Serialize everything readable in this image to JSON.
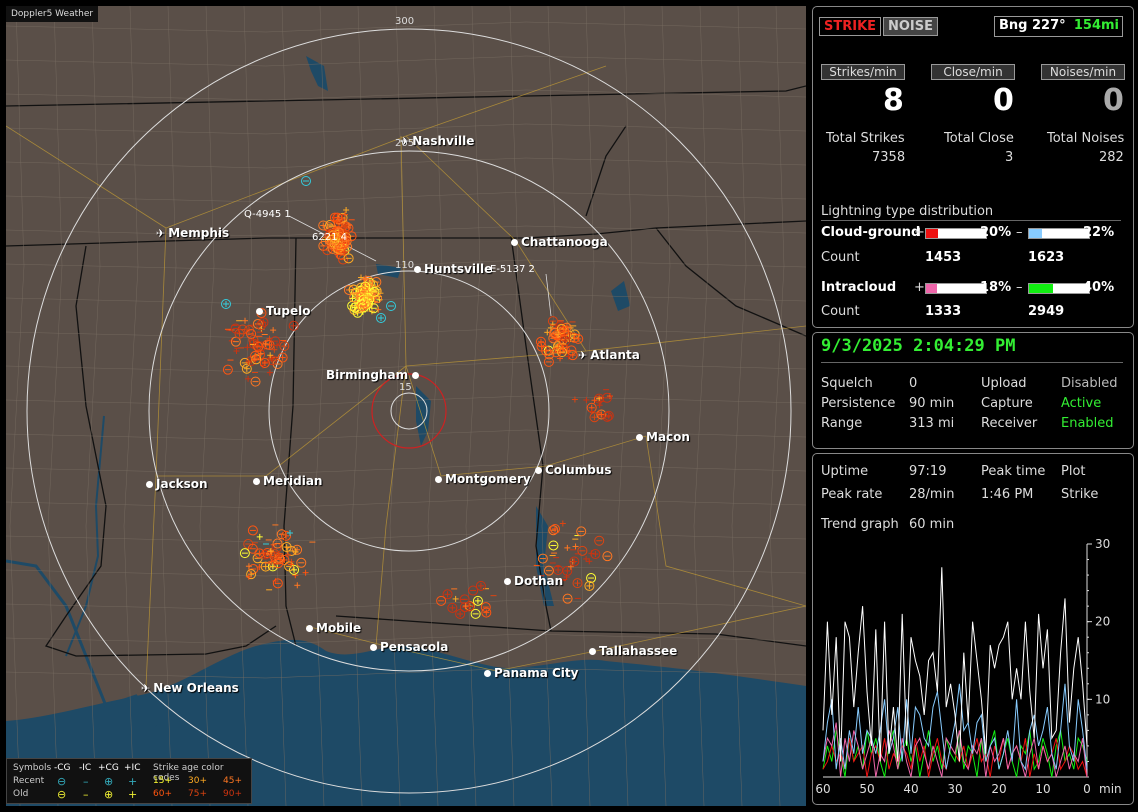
{
  "app": {
    "title": "Doppler5 Weather"
  },
  "map": {
    "range_labels": [
      "300",
      "205",
      "110",
      "15"
    ],
    "cities": [
      {
        "name": "Nashville",
        "type": "airport"
      },
      {
        "name": "Memphis",
        "type": "airport"
      },
      {
        "name": "Chattanooga",
        "type": "city"
      },
      {
        "name": "Huntsville",
        "type": "city"
      },
      {
        "name": "Tupelo",
        "type": "city"
      },
      {
        "name": "Atlanta",
        "type": "airport"
      },
      {
        "name": "Birmingham",
        "type": "city"
      },
      {
        "name": "Macon",
        "type": "city"
      },
      {
        "name": "Jackson",
        "type": "city"
      },
      {
        "name": "Meridian",
        "type": "city"
      },
      {
        "name": "Montgomery",
        "type": "city"
      },
      {
        "name": "Columbus",
        "type": "city"
      },
      {
        "name": "Dothan",
        "type": "city"
      },
      {
        "name": "Mobile",
        "type": "city"
      },
      {
        "name": "Pensacola",
        "type": "city"
      },
      {
        "name": "Tallahassee",
        "type": "city"
      },
      {
        "name": "Panama City",
        "type": "city"
      },
      {
        "name": "New Orleans",
        "type": "airport"
      }
    ],
    "projections": [
      "Q-4945 1",
      "6221 4",
      "E-5137 2"
    ],
    "colors": {
      "land": "#5a4f48",
      "water": "#1e4a66",
      "range_ring": "#dddddd",
      "close_ring": "#cc2222"
    }
  },
  "legend": {
    "symbols_label": "Symbols",
    "headers": [
      "-CG",
      "-IC",
      "+CG",
      "+IC"
    ],
    "recent_label": "Recent",
    "old_label": "Old",
    "age_label": "Strike age color codes",
    "recent_ages": [
      "15+",
      "30+",
      "45+"
    ],
    "old_ages": [
      "60+",
      "75+",
      "90+"
    ],
    "age_colors": [
      "#ffff33",
      "#ffaa22",
      "#ff7722",
      "#ff5511",
      "#dd4411",
      "#cc3311"
    ]
  },
  "status": {
    "strike_btn": "STRIKE",
    "noise_btn": "NOISE",
    "bearing": "Bng 227°",
    "distance": "154mi",
    "headers": [
      "Strikes/min",
      "Close/min",
      "Noises/min"
    ],
    "strikes_per_min": "8",
    "close_per_min": "0",
    "noises_per_min": "0",
    "total_labels": [
      "Total Strikes",
      "Total Close",
      "Total Noises"
    ],
    "total_strikes": "7358",
    "total_close": "3",
    "total_noises": "282"
  },
  "distribution": {
    "title": "Lightning type distribution",
    "cloud_ground_label": "Cloud-ground",
    "intracloud_label": "Intracloud",
    "count_label": "Count",
    "plus": "+",
    "minus": "–",
    "cg_pos_pct": "20%",
    "cg_pos_frac": 0.2,
    "cg_pos_color": "#ee1111",
    "cg_neg_pct": "22%",
    "cg_neg_frac": 0.22,
    "cg_neg_color": "#88ccff",
    "cg_pos_count": "1453",
    "cg_neg_count": "1623",
    "ic_pos_pct": "18%",
    "ic_pos_frac": 0.18,
    "ic_pos_color": "#ee66aa",
    "ic_neg_pct": "40%",
    "ic_neg_frac": 0.4,
    "ic_neg_color": "#11ee11",
    "ic_pos_count": "1333",
    "ic_neg_count": "2949"
  },
  "settings": {
    "datetime": "9/3/2025 2:04:29 PM",
    "squelch_label": "Squelch",
    "squelch": "0",
    "persistence_label": "Persistence",
    "persistence": "90 min",
    "range_label": "Range",
    "range": "313 mi",
    "upload_label": "Upload",
    "upload": "Disabled",
    "capture_label": "Capture",
    "capture": "Active",
    "receiver_label": "Receiver",
    "receiver": "Enabled"
  },
  "stats": {
    "uptime_label": "Uptime",
    "uptime": "97:19",
    "peak_time_label": "Peak time",
    "peak_time": "1:46 PM",
    "plot_label": "Plot",
    "plot": "Strike",
    "peak_rate_label": "Peak rate",
    "peak_rate": "28/min",
    "trend_label": "Trend graph",
    "trend_window": "60 min"
  },
  "chart_data": {
    "type": "line",
    "title": "",
    "xlabel": "min",
    "ylabel": "",
    "x_ticks": [
      "60",
      "50",
      "40",
      "30",
      "20",
      "10",
      "0"
    ],
    "y_ticks": [
      "30",
      "20",
      "10"
    ],
    "ylim": [
      0,
      30
    ],
    "xlim": [
      60,
      0
    ],
    "series": [
      {
        "color": "#ffffff",
        "values": [
          6,
          20,
          8,
          18,
          2,
          20,
          18,
          9,
          16,
          22,
          11,
          4,
          19,
          2,
          20,
          3,
          9,
          2,
          21,
          4,
          18,
          15,
          13,
          8,
          15,
          16,
          11,
          27,
          9,
          12,
          8,
          2,
          16,
          7,
          20,
          15,
          10,
          3,
          17,
          14,
          17,
          18,
          20,
          10,
          14,
          10,
          20,
          11,
          5,
          21,
          14,
          19,
          5,
          6,
          16,
          23,
          7,
          14,
          18,
          12,
          4
        ]
      },
      {
        "color": "#88ccff",
        "values": [
          2,
          7,
          10,
          1,
          5,
          1,
          6,
          3,
          9,
          3,
          6,
          5,
          3,
          6,
          10,
          3,
          5,
          9,
          2,
          10,
          3,
          9,
          8,
          5,
          4,
          9,
          11,
          6,
          1,
          4,
          7,
          12,
          6,
          7,
          3,
          7,
          8,
          2,
          4,
          5,
          1,
          3,
          6,
          2,
          10,
          2,
          1,
          6,
          8,
          4,
          6,
          9,
          3,
          1,
          6,
          12,
          4,
          2,
          10,
          6,
          1
        ]
      },
      {
        "color": "#ee66aa",
        "values": [
          2,
          5,
          4,
          7,
          0,
          5,
          2,
          6,
          4,
          1,
          3,
          5,
          0,
          3,
          2,
          6,
          4,
          1,
          5,
          2,
          0,
          4,
          5,
          3,
          1,
          4,
          2,
          0,
          5,
          4,
          3,
          6,
          2,
          1,
          4,
          3,
          5,
          0,
          4,
          2,
          3,
          5,
          1,
          3,
          4,
          2,
          0,
          3,
          5,
          1,
          4,
          2,
          3,
          0,
          2,
          4,
          1,
          3,
          2,
          5,
          0
        ]
      },
      {
        "color": "#ee1111",
        "values": [
          1,
          2,
          4,
          2,
          3,
          1,
          5,
          2,
          3,
          4,
          0,
          3,
          4,
          2,
          5,
          1,
          3,
          2,
          4,
          3,
          1,
          5,
          2,
          4,
          0,
          3,
          5,
          2,
          1,
          4,
          3,
          2,
          4,
          1,
          3,
          5,
          2,
          3,
          0,
          4,
          2,
          5,
          1,
          3,
          4,
          2,
          5,
          0,
          3,
          1,
          4,
          2,
          3,
          5,
          1,
          2,
          4,
          3,
          1,
          2,
          0
        ]
      },
      {
        "color": "#11ee11",
        "values": [
          1,
          4,
          2,
          6,
          3,
          0,
          5,
          2,
          4,
          1,
          6,
          3,
          5,
          2,
          0,
          4,
          6,
          1,
          3,
          5,
          2,
          4,
          0,
          3,
          6,
          2,
          4,
          1,
          5,
          3,
          2,
          6,
          1,
          4,
          3,
          0,
          5,
          2,
          4,
          6,
          1,
          3,
          5,
          2,
          0,
          4,
          3,
          6,
          1,
          2,
          5,
          3,
          0,
          4,
          6,
          2,
          3,
          1,
          5,
          4,
          2
        ]
      }
    ]
  }
}
